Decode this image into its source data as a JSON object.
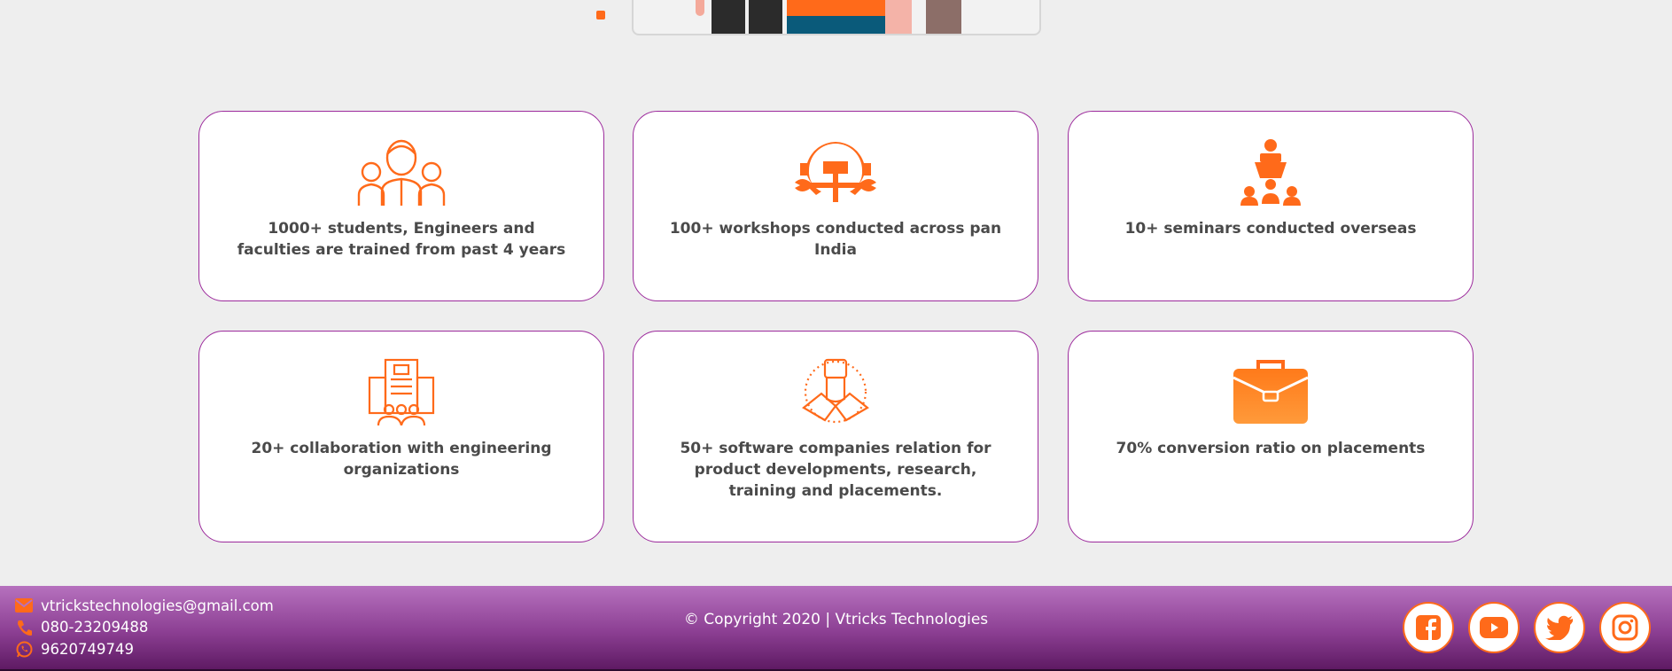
{
  "colors": {
    "accent": "#ff6a1a",
    "card_border": "#9c2a9c",
    "footer_top": "#b671be",
    "footer_bottom": "#5e1a63"
  },
  "stats": [
    {
      "icon": "people-icon",
      "text": "1000+ students, Engineers and faculties are trained from past 4 years"
    },
    {
      "icon": "workshop-gear-icon",
      "text": "100+ workshops conducted across pan India"
    },
    {
      "icon": "seminar-presenter-icon",
      "text": "10+ seminars conducted overseas"
    },
    {
      "icon": "building-collaboration-icon",
      "text": "20+ collaboration with engineering organizations"
    },
    {
      "icon": "handshake-icon",
      "text": "50+ software companies relation for product developments, research, training and placements."
    },
    {
      "icon": "briefcase-icon",
      "text": "70% conversion ratio on placements"
    }
  ],
  "footer": {
    "email": "vtrickstechnologies@gmail.com",
    "phone": "080-23209488",
    "whatsapp": "9620749749",
    "copyright": "© Copyright 2020 | Vtricks Technologies",
    "social": [
      "facebook-icon",
      "youtube-icon",
      "twitter-icon",
      "instagram-icon"
    ]
  }
}
